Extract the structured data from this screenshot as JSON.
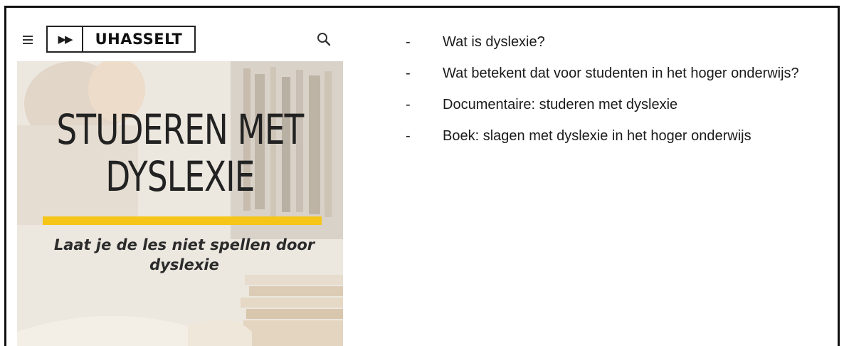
{
  "header": {
    "logo_arrows": "▶▶",
    "logo_text": "UHASSELT",
    "menu_icon": "hamburger-menu-icon",
    "search_icon": "search-icon"
  },
  "hero": {
    "title_line1": "STUDEREN MET",
    "title_line2": "DYSLEXIE",
    "subtitle": "Laat je de les niet spellen door dyslexie",
    "accent_color": "#f5c518"
  },
  "topics": [
    {
      "dash": "-",
      "text": "Wat is dyslexie?"
    },
    {
      "dash": "-",
      "text": "Wat betekent dat voor studenten in het hoger onderwijs?"
    },
    {
      "dash": "-",
      "text": "Documentaire: studeren met dyslexie"
    },
    {
      "dash": "-",
      "text": "Boek: slagen met dyslexie in het hoger onderwijs"
    }
  ]
}
